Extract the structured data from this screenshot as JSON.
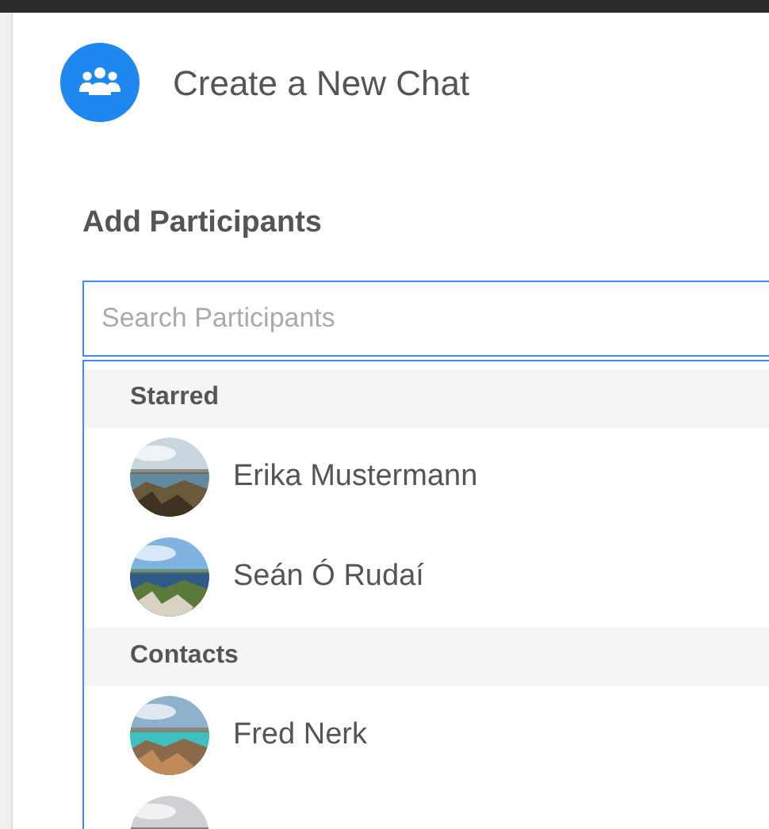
{
  "header": {
    "title": "Create a New Chat"
  },
  "participants": {
    "heading": "Add Participants",
    "search": {
      "placeholder": "Search Participants",
      "focused": true
    },
    "sections": [
      {
        "title": "Starred",
        "items": [
          {
            "name": "Erika Mustermann",
            "avatar": {
              "kind": "picture"
            }
          },
          {
            "name": "Seán Ó Rudaí",
            "avatar": {
              "kind": "picture"
            }
          }
        ]
      },
      {
        "title": "Contacts",
        "items": [
          {
            "name": "Fred Nerk",
            "avatar": {
              "kind": "picture"
            }
          },
          {
            "avatar": {
              "kind": "picture"
            }
          }
        ]
      }
    ]
  }
}
